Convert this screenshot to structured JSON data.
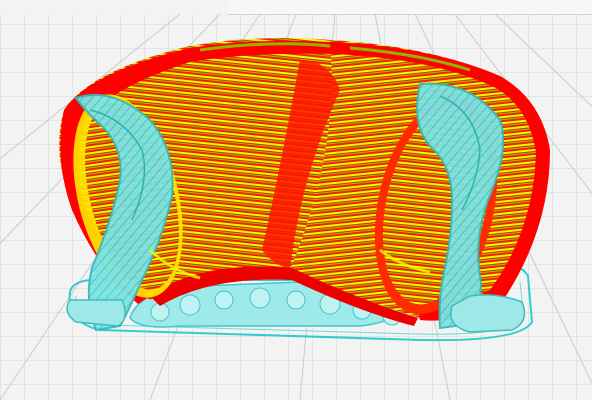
{
  "viewport": {
    "view": "layer-preview",
    "background_color": "#f3f3f3",
    "grid_color": "#c9ced3",
    "colors": {
      "wall_outer": "#ff0000",
      "wall_inner": "#e8ff00",
      "infill": "#7ddf00",
      "support": "#55d6d6",
      "skirt": "#33cccc"
    },
    "icons": []
  }
}
